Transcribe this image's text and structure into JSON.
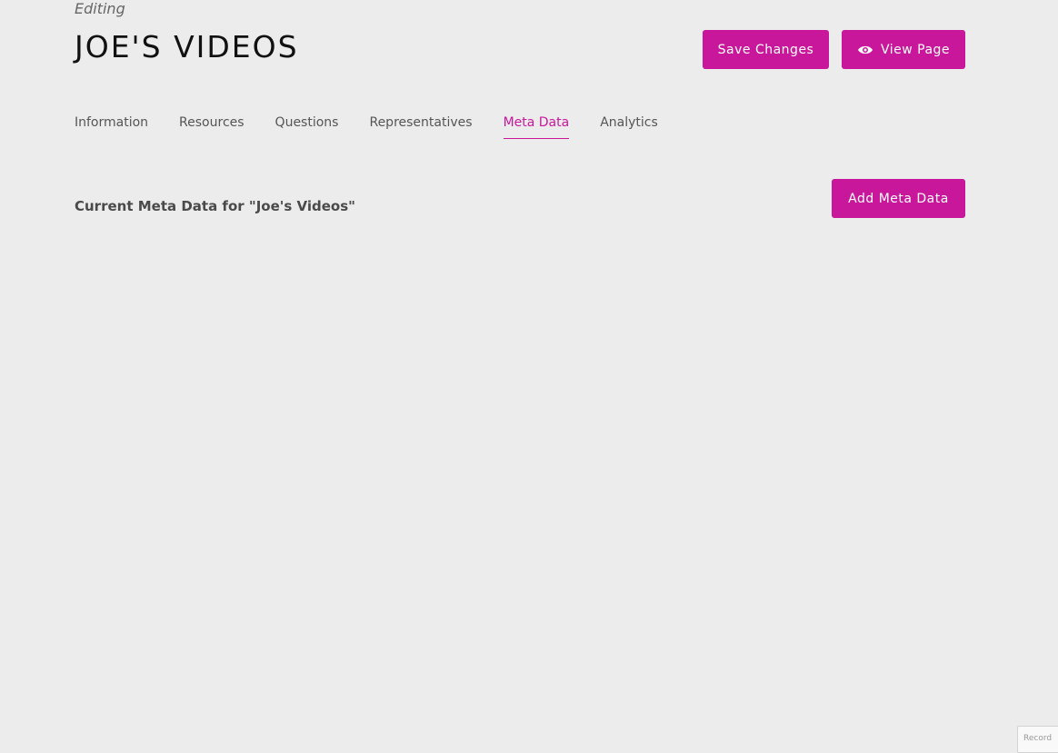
{
  "header": {
    "editing_label": "Editing",
    "title": "JOE'S VIDEOS",
    "save_label": "Save Changes",
    "view_label": "View Page",
    "view_icon": "eye-icon"
  },
  "tabs": [
    {
      "label": "Information"
    },
    {
      "label": "Resources"
    },
    {
      "label": "Questions"
    },
    {
      "label": "Representatives"
    },
    {
      "label": "Meta Data",
      "active": true
    },
    {
      "label": "Analytics"
    }
  ],
  "content": {
    "heading": "Current Meta Data for \"Joe's Videos\"",
    "add_label": "Add Meta Data"
  },
  "recaptcha": {
    "label": "Record"
  },
  "colors": {
    "accent": "#c8179a",
    "background": "#ececec"
  }
}
